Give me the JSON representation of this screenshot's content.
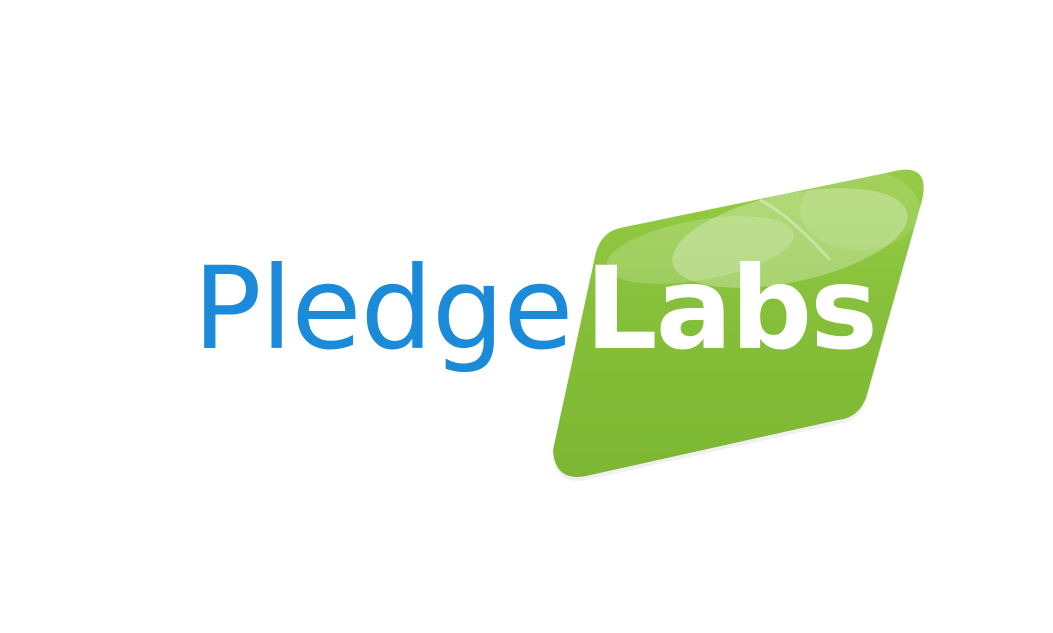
{
  "logo": {
    "name_part_1": "Pledge",
    "name_part_2": "Labs",
    "colors": {
      "background": "#ffffff",
      "pledge_text": "#1b8ad8",
      "labs_text": "#ffffff",
      "badge_green": "#84bf37",
      "badge_green_light": "#9cd14c"
    }
  }
}
